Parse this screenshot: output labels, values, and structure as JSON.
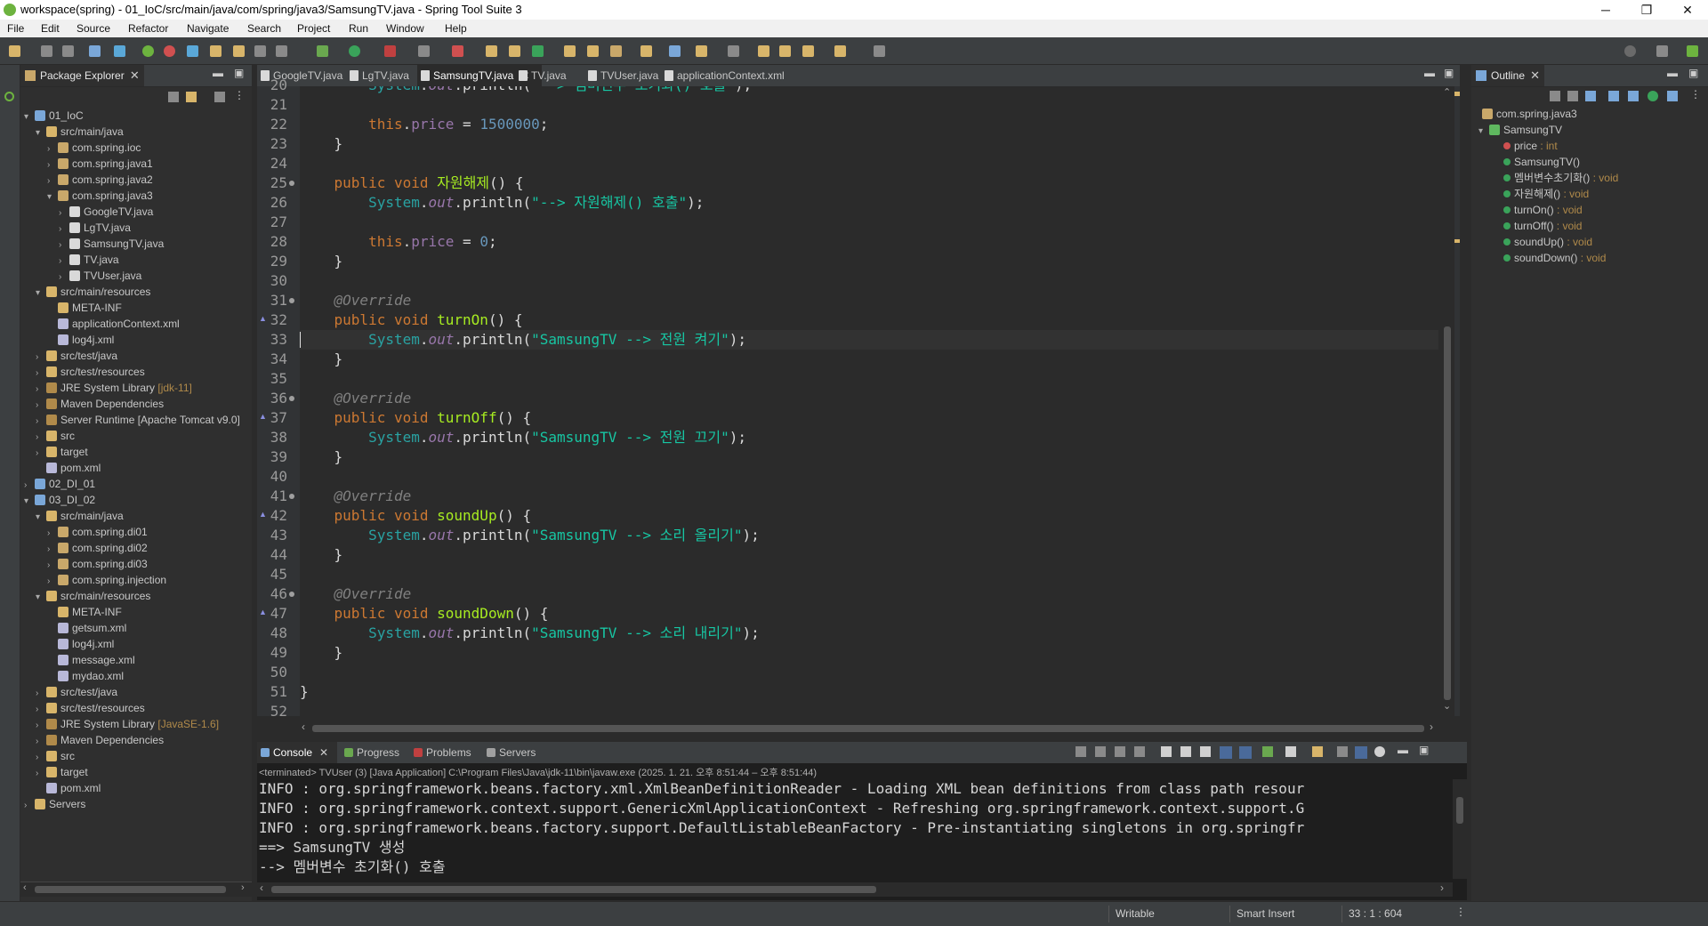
{
  "window": {
    "title": "workspace(spring) - 01_IoC/src/main/java/com/spring/java3/SamsungTV.java - Spring Tool Suite 3",
    "minimize": "─",
    "maximize": "❐",
    "close": "✕"
  },
  "menu": [
    "File",
    "Edit",
    "Source",
    "Refactor",
    "Navigate",
    "Search",
    "Project",
    "Run",
    "Window",
    "Help"
  ],
  "package_explorer": {
    "title": "Package Explorer",
    "close": "✕",
    "tree": [
      {
        "label": "01_IoC",
        "deco": "",
        "depth": 0,
        "arrow": "▾",
        "icon": "project-icon"
      },
      {
        "label": "src/main/java",
        "deco": "",
        "depth": 1,
        "arrow": "▾",
        "icon": "source-folder-icon"
      },
      {
        "label": "com.spring.ioc",
        "deco": "",
        "depth": 2,
        "arrow": "›",
        "icon": "package-icon"
      },
      {
        "label": "com.spring.java1",
        "deco": "",
        "depth": 2,
        "arrow": "›",
        "icon": "package-icon"
      },
      {
        "label": "com.spring.java2",
        "deco": "",
        "depth": 2,
        "arrow": "›",
        "icon": "package-icon"
      },
      {
        "label": "com.spring.java3",
        "deco": "",
        "depth": 2,
        "arrow": "▾",
        "icon": "package-icon"
      },
      {
        "label": "GoogleTV.java",
        "deco": "",
        "depth": 3,
        "arrow": "›",
        "icon": "java-file-icon"
      },
      {
        "label": "LgTV.java",
        "deco": "",
        "depth": 3,
        "arrow": "›",
        "icon": "java-file-icon"
      },
      {
        "label": "SamsungTV.java",
        "deco": "",
        "depth": 3,
        "arrow": "›",
        "icon": "java-file-icon"
      },
      {
        "label": "TV.java",
        "deco": "",
        "depth": 3,
        "arrow": "›",
        "icon": "java-file-icon"
      },
      {
        "label": "TVUser.java",
        "deco": "",
        "depth": 3,
        "arrow": "›",
        "icon": "java-file-icon"
      },
      {
        "label": "src/main/resources",
        "deco": "",
        "depth": 1,
        "arrow": "▾",
        "icon": "source-folder-icon"
      },
      {
        "label": "META-INF",
        "deco": "",
        "depth": 2,
        "arrow": "",
        "icon": "folder-icon"
      },
      {
        "label": "applicationContext.xml",
        "deco": "",
        "depth": 2,
        "arrow": "",
        "icon": "xml-file-icon"
      },
      {
        "label": "log4j.xml",
        "deco": "",
        "depth": 2,
        "arrow": "",
        "icon": "xml-file-icon"
      },
      {
        "label": "src/test/java",
        "deco": "",
        "depth": 1,
        "arrow": "›",
        "icon": "source-folder-icon"
      },
      {
        "label": "src/test/resources",
        "deco": "",
        "depth": 1,
        "arrow": "›",
        "icon": "source-folder-icon"
      },
      {
        "label": "JRE System Library",
        "deco": "[jdk-11]",
        "depth": 1,
        "arrow": "›",
        "icon": "library-icon"
      },
      {
        "label": "Maven Dependencies",
        "deco": "",
        "depth": 1,
        "arrow": "›",
        "icon": "library-icon"
      },
      {
        "label": "Server Runtime [Apache Tomcat v9.0]",
        "deco": "",
        "depth": 1,
        "arrow": "›",
        "icon": "library-icon"
      },
      {
        "label": "src",
        "deco": "",
        "depth": 1,
        "arrow": "›",
        "icon": "folder-icon"
      },
      {
        "label": "target",
        "deco": "",
        "depth": 1,
        "arrow": "›",
        "icon": "folder-icon"
      },
      {
        "label": "pom.xml",
        "deco": "",
        "depth": 1,
        "arrow": "",
        "icon": "xml-file-icon"
      },
      {
        "label": "02_DI_01",
        "deco": "",
        "depth": 0,
        "arrow": "›",
        "icon": "project-icon"
      },
      {
        "label": "03_DI_02",
        "deco": "",
        "depth": 0,
        "arrow": "▾",
        "icon": "project-icon"
      },
      {
        "label": "src/main/java",
        "deco": "",
        "depth": 1,
        "arrow": "▾",
        "icon": "source-folder-icon"
      },
      {
        "label": "com.spring.di01",
        "deco": "",
        "depth": 2,
        "arrow": "›",
        "icon": "package-icon"
      },
      {
        "label": "com.spring.di02",
        "deco": "",
        "depth": 2,
        "arrow": "›",
        "icon": "package-icon"
      },
      {
        "label": "com.spring.di03",
        "deco": "",
        "depth": 2,
        "arrow": "›",
        "icon": "package-icon"
      },
      {
        "label": "com.spring.injection",
        "deco": "",
        "depth": 2,
        "arrow": "›",
        "icon": "package-icon"
      },
      {
        "label": "src/main/resources",
        "deco": "",
        "depth": 1,
        "arrow": "▾",
        "icon": "source-folder-icon"
      },
      {
        "label": "META-INF",
        "deco": "",
        "depth": 2,
        "arrow": "",
        "icon": "folder-icon"
      },
      {
        "label": "getsum.xml",
        "deco": "",
        "depth": 2,
        "arrow": "",
        "icon": "xml-file-icon"
      },
      {
        "label": "log4j.xml",
        "deco": "",
        "depth": 2,
        "arrow": "",
        "icon": "xml-file-icon"
      },
      {
        "label": "message.xml",
        "deco": "",
        "depth": 2,
        "arrow": "",
        "icon": "xml-file-icon"
      },
      {
        "label": "mydao.xml",
        "deco": "",
        "depth": 2,
        "arrow": "",
        "icon": "xml-file-icon"
      },
      {
        "label": "src/test/java",
        "deco": "",
        "depth": 1,
        "arrow": "›",
        "icon": "source-folder-icon"
      },
      {
        "label": "src/test/resources",
        "deco": "",
        "depth": 1,
        "arrow": "›",
        "icon": "source-folder-icon"
      },
      {
        "label": "JRE System Library",
        "deco": "[JavaSE-1.6]",
        "depth": 1,
        "arrow": "›",
        "icon": "library-icon"
      },
      {
        "label": "Maven Dependencies",
        "deco": "",
        "depth": 1,
        "arrow": "›",
        "icon": "library-icon"
      },
      {
        "label": "src",
        "deco": "",
        "depth": 1,
        "arrow": "›",
        "icon": "folder-icon"
      },
      {
        "label": "target",
        "deco": "",
        "depth": 1,
        "arrow": "›",
        "icon": "folder-icon"
      },
      {
        "label": "pom.xml",
        "deco": "",
        "depth": 1,
        "arrow": "",
        "icon": "xml-file-icon"
      },
      {
        "label": "Servers",
        "deco": "",
        "depth": 0,
        "arrow": "›",
        "icon": "folder-icon"
      }
    ]
  },
  "editor": {
    "tabs": [
      {
        "label": "GoogleTV.java",
        "active": false
      },
      {
        "label": "LgTV.java",
        "active": false
      },
      {
        "label": "SamsungTV.java",
        "active": true
      },
      {
        "label": "TV.java",
        "active": false
      },
      {
        "label": "TVUser.java",
        "active": false
      },
      {
        "label": "applicationContext.xml",
        "active": false
      }
    ],
    "tab_close": "✕",
    "lines": [
      {
        "n": "20",
        "html": "        <span class=\"sys\">System</span>.<span class=\"out\">out</span>.println(<span class=\"str\">\"--> 멤버변수 초기화() 호출\"</span>);",
        "fold": false,
        "ovr": false
      },
      {
        "n": "21",
        "html": "",
        "fold": false,
        "ovr": false
      },
      {
        "n": "22",
        "html": "        <span class=\"kw\">this</span>.<span class=\"fld\">price</span> = <span class=\"num\">1500000</span>;",
        "fold": false,
        "ovr": false
      },
      {
        "n": "23",
        "html": "    }",
        "fold": false,
        "ovr": false
      },
      {
        "n": "24",
        "html": "",
        "fold": false,
        "ovr": false
      },
      {
        "n": "25",
        "html": "    <span class=\"kw\">public void</span> <span class=\"mname\">자원해제</span>() {",
        "fold": true,
        "ovr": false
      },
      {
        "n": "26",
        "html": "        <span class=\"sys\">System</span>.<span class=\"out\">out</span>.println(<span class=\"str\">\"--> 자원해제() 호출\"</span>);",
        "fold": false,
        "ovr": false
      },
      {
        "n": "27",
        "html": "",
        "fold": false,
        "ovr": false
      },
      {
        "n": "28",
        "html": "        <span class=\"kw\">this</span>.<span class=\"fld\">price</span> = <span class=\"num\">0</span>;",
        "fold": false,
        "ovr": false
      },
      {
        "n": "29",
        "html": "    }",
        "fold": false,
        "ovr": false
      },
      {
        "n": "30",
        "html": "",
        "fold": false,
        "ovr": false
      },
      {
        "n": "31",
        "html": "    <span class=\"ann\">@Override</span>",
        "fold": true,
        "ovr": false
      },
      {
        "n": "32",
        "html": "    <span class=\"kw\">public void</span> <span class=\"mname\">turnOn</span>() {",
        "fold": false,
        "ovr": true
      },
      {
        "n": "33",
        "html": "        <span class=\"sys\">System</span>.<span class=\"out\">out</span>.println(<span class=\"str\">\"SamsungTV --> 전원 켜기\"</span>);",
        "fold": false,
        "ovr": false,
        "current": true
      },
      {
        "n": "34",
        "html": "    }",
        "fold": false,
        "ovr": false
      },
      {
        "n": "35",
        "html": "",
        "fold": false,
        "ovr": false
      },
      {
        "n": "36",
        "html": "    <span class=\"ann\">@Override</span>",
        "fold": true,
        "ovr": false
      },
      {
        "n": "37",
        "html": "    <span class=\"kw\">public void</span> <span class=\"mname\">turnOff</span>() {",
        "fold": false,
        "ovr": true
      },
      {
        "n": "38",
        "html": "        <span class=\"sys\">System</span>.<span class=\"out\">out</span>.println(<span class=\"str\">\"SamsungTV --> 전원 끄기\"</span>);",
        "fold": false,
        "ovr": false
      },
      {
        "n": "39",
        "html": "    }",
        "fold": false,
        "ovr": false
      },
      {
        "n": "40",
        "html": "",
        "fold": false,
        "ovr": false
      },
      {
        "n": "41",
        "html": "    <span class=\"ann\">@Override</span>",
        "fold": true,
        "ovr": false
      },
      {
        "n": "42",
        "html": "    <span class=\"kw\">public void</span> <span class=\"mname\">soundUp</span>() {",
        "fold": false,
        "ovr": true
      },
      {
        "n": "43",
        "html": "        <span class=\"sys\">System</span>.<span class=\"out\">out</span>.println(<span class=\"str\">\"SamsungTV --> 소리 올리기\"</span>);",
        "fold": false,
        "ovr": false
      },
      {
        "n": "44",
        "html": "    }",
        "fold": false,
        "ovr": false
      },
      {
        "n": "45",
        "html": "",
        "fold": false,
        "ovr": false
      },
      {
        "n": "46",
        "html": "    <span class=\"ann\">@Override</span>",
        "fold": true,
        "ovr": false
      },
      {
        "n": "47",
        "html": "    <span class=\"kw\">public void</span> <span class=\"mname\">soundDown</span>() {",
        "fold": false,
        "ovr": true
      },
      {
        "n": "48",
        "html": "        <span class=\"sys\">System</span>.<span class=\"out\">out</span>.println(<span class=\"str\">\"SamsungTV --> 소리 내리기\"</span>);",
        "fold": false,
        "ovr": false
      },
      {
        "n": "49",
        "html": "    }",
        "fold": false,
        "ovr": false
      },
      {
        "n": "50",
        "html": "",
        "fold": false,
        "ovr": false
      },
      {
        "n": "51",
        "html": "}",
        "fold": false,
        "ovr": false
      },
      {
        "n": "52",
        "html": "",
        "fold": false,
        "ovr": false
      }
    ]
  },
  "outline": {
    "title": "Outline",
    "close": "✕",
    "items": [
      {
        "label": "com.spring.java3",
        "type": "",
        "depth": 0,
        "icon": "package-icon",
        "color": "#c9a86a"
      },
      {
        "label": "SamsungTV",
        "type": "",
        "depth": 0,
        "icon": "class-icon",
        "color": "#5fb85f"
      },
      {
        "label": "price",
        "type": " : int",
        "depth": 1,
        "icon": "private-field-icon",
        "color": "#d05050"
      },
      {
        "label": "SamsungTV()",
        "type": "",
        "depth": 1,
        "icon": "constructor-icon",
        "color": "#3aa35a"
      },
      {
        "label": "멤버변수초기화()",
        "type": " : void",
        "depth": 1,
        "icon": "method-icon",
        "color": "#3aa35a"
      },
      {
        "label": "자원해제()",
        "type": " : void",
        "depth": 1,
        "icon": "method-icon",
        "color": "#3aa35a"
      },
      {
        "label": "turnOn()",
        "type": " : void",
        "depth": 1,
        "icon": "override-method-icon",
        "color": "#3aa35a"
      },
      {
        "label": "turnOff()",
        "type": " : void",
        "depth": 1,
        "icon": "override-method-icon",
        "color": "#3aa35a"
      },
      {
        "label": "soundUp()",
        "type": " : void",
        "depth": 1,
        "icon": "override-method-icon",
        "color": "#3aa35a"
      },
      {
        "label": "soundDown()",
        "type": " : void",
        "depth": 1,
        "icon": "override-method-icon",
        "color": "#3aa35a"
      }
    ]
  },
  "console": {
    "tabs": [
      {
        "label": "Console",
        "active": true,
        "icon": "console-icon",
        "color": "#7aa7d8"
      },
      {
        "label": "Progress",
        "active": false,
        "icon": "progress-icon",
        "color": "#6aa84f"
      },
      {
        "label": "Problems",
        "active": false,
        "icon": "problems-icon",
        "color": "#c04040"
      },
      {
        "label": "Servers",
        "active": false,
        "icon": "servers-icon",
        "color": "#a0a0a0"
      }
    ],
    "close": "✕",
    "header": "<terminated> TVUser (3) [Java Application] C:\\Program Files\\Java\\jdk-11\\bin\\javaw.exe  (2025. 1. 21. 오후 8:51:44 – 오후 8:51:44)",
    "lines": [
      "INFO : org.springframework.beans.factory.xml.XmlBeanDefinitionReader - Loading XML bean definitions from class path resour",
      "INFO : org.springframework.context.support.GenericXmlApplicationContext - Refreshing org.springframework.context.support.G",
      "INFO : org.springframework.beans.factory.support.DefaultListableBeanFactory - Pre-instantiating singletons in org.springfr",
      "==> SamsungTV 생성",
      "--> 멤버변수 초기화() 호출"
    ]
  },
  "status": {
    "writable": "Writable",
    "insert_mode": "Smart Insert",
    "position": "33 : 1 : 604"
  },
  "colors": {
    "editor_bg": "#2b2b2b",
    "panel_bg": "#2f2f2f",
    "keyword": "#cc7832",
    "string": "#17c6a3",
    "method_name": "#a7ec21"
  }
}
